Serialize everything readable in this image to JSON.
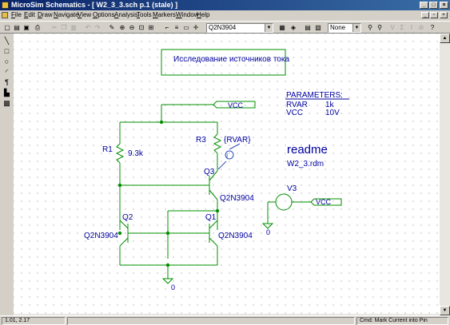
{
  "window": {
    "title": "MicroSim Schematics - [ W2_3_3.sch  p.1 (stale)  ]",
    "minimize_glyph": "_",
    "maximize_glyph": "□",
    "close_glyph": "×"
  },
  "menu": {
    "items": [
      {
        "key": "F",
        "rest": "ile"
      },
      {
        "key": "E",
        "rest": "dit"
      },
      {
        "key": "D",
        "rest": "raw"
      },
      {
        "key": "N",
        "rest": "avigate"
      },
      {
        "key": "V",
        "rest": "iew"
      },
      {
        "key": "O",
        "rest": "ptions"
      },
      {
        "key": "A",
        "rest": "nalysis"
      },
      {
        "key": "T",
        "rest": "ools"
      },
      {
        "key": "M",
        "rest": "arkers"
      },
      {
        "key": "W",
        "rest": "indow"
      },
      {
        "key": "H",
        "rest": "elp"
      }
    ]
  },
  "toolbar": {
    "part_combo": "Q2N3904",
    "style_combo": "None"
  },
  "schematic": {
    "title_box": "Исследование источников тока",
    "parameters_header": "PARAMETERS:",
    "param1_name": "RVAR",
    "param1_value": "1k",
    "param2_name": "VCC",
    "param2_value": "10V",
    "vcc_label_top": "VCC",
    "vcc_label_right": "VCC",
    "r1_name": "R1",
    "r1_value": "9.3k",
    "r3_name": "R3",
    "r3_value": "{RVAR}",
    "ammeter_marker": "I",
    "q3_name": "Q3",
    "q3_model": "Q2N3904",
    "q2_name": "Q2",
    "q2_model": "Q2N3904",
    "q1_name": "Q1",
    "q1_model": "Q2N3904",
    "v3_name": "V3",
    "ground_0_a": "0",
    "ground_0_b": "0",
    "readme_title": "readme",
    "readme_file": "W2_3.rdm"
  },
  "status": {
    "coords": "1.01,  2.17",
    "command": "Cmd: Mark Current into Pin"
  }
}
